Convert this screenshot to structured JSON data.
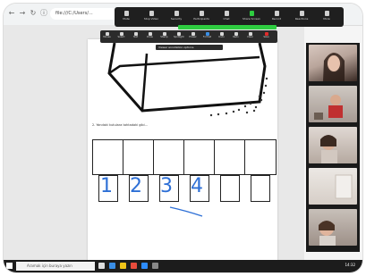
{
  "browser": {
    "address_text": "file:///C:/Users/...",
    "nav_icons": [
      "back-icon",
      "forward-icon",
      "reload-icon"
    ]
  },
  "zoom_toolbar": {
    "items": [
      {
        "label": "Mute",
        "icon": "microphone-icon"
      },
      {
        "label": "Stop Video",
        "icon": "video-icon"
      },
      {
        "label": "Security",
        "icon": "shield-icon"
      },
      {
        "label": "Participants",
        "icon": "participants-icon"
      },
      {
        "label": "Chat",
        "icon": "chat-icon"
      },
      {
        "label": "Share Screen",
        "icon": "share-screen-icon"
      },
      {
        "label": "Record",
        "icon": "record-icon"
      },
      {
        "label": "Reactions",
        "icon": "reactions-icon"
      },
      {
        "label": "More",
        "icon": "more-icon"
      }
    ],
    "sharing_notice": "You are screen sharing"
  },
  "annotation_toolbar": {
    "items": [
      {
        "label": "Mouse",
        "icon": "cursor-icon"
      },
      {
        "label": "Select",
        "icon": "select-icon"
      },
      {
        "label": "Text",
        "icon": "text-icon"
      },
      {
        "label": "Draw",
        "icon": "pen-icon"
      },
      {
        "label": "Stamp",
        "icon": "stamp-icon"
      },
      {
        "label": "Spotlight",
        "icon": "spotlight-icon"
      },
      {
        "label": "Eraser",
        "icon": "eraser-icon"
      },
      {
        "label": "Format",
        "icon": "format-icon"
      },
      {
        "label": "Undo",
        "icon": "undo-icon"
      },
      {
        "label": "Redo",
        "icon": "redo-icon"
      },
      {
        "label": "Clear",
        "icon": "clear-icon"
      },
      {
        "label": "Save",
        "icon": "save-icon"
      }
    ],
    "tooltip": "Viewer annotation options"
  },
  "document": {
    "question_text": "2. Yandaki kutulara tahtadaki gibi...",
    "handwritten_numbers": [
      "1",
      "2",
      "3",
      "4"
    ]
  },
  "participants": {
    "count_tiles": 5
  },
  "taskbar": {
    "search_placeholder": "Aramak için buraya yazın",
    "clock": "14:32"
  }
}
